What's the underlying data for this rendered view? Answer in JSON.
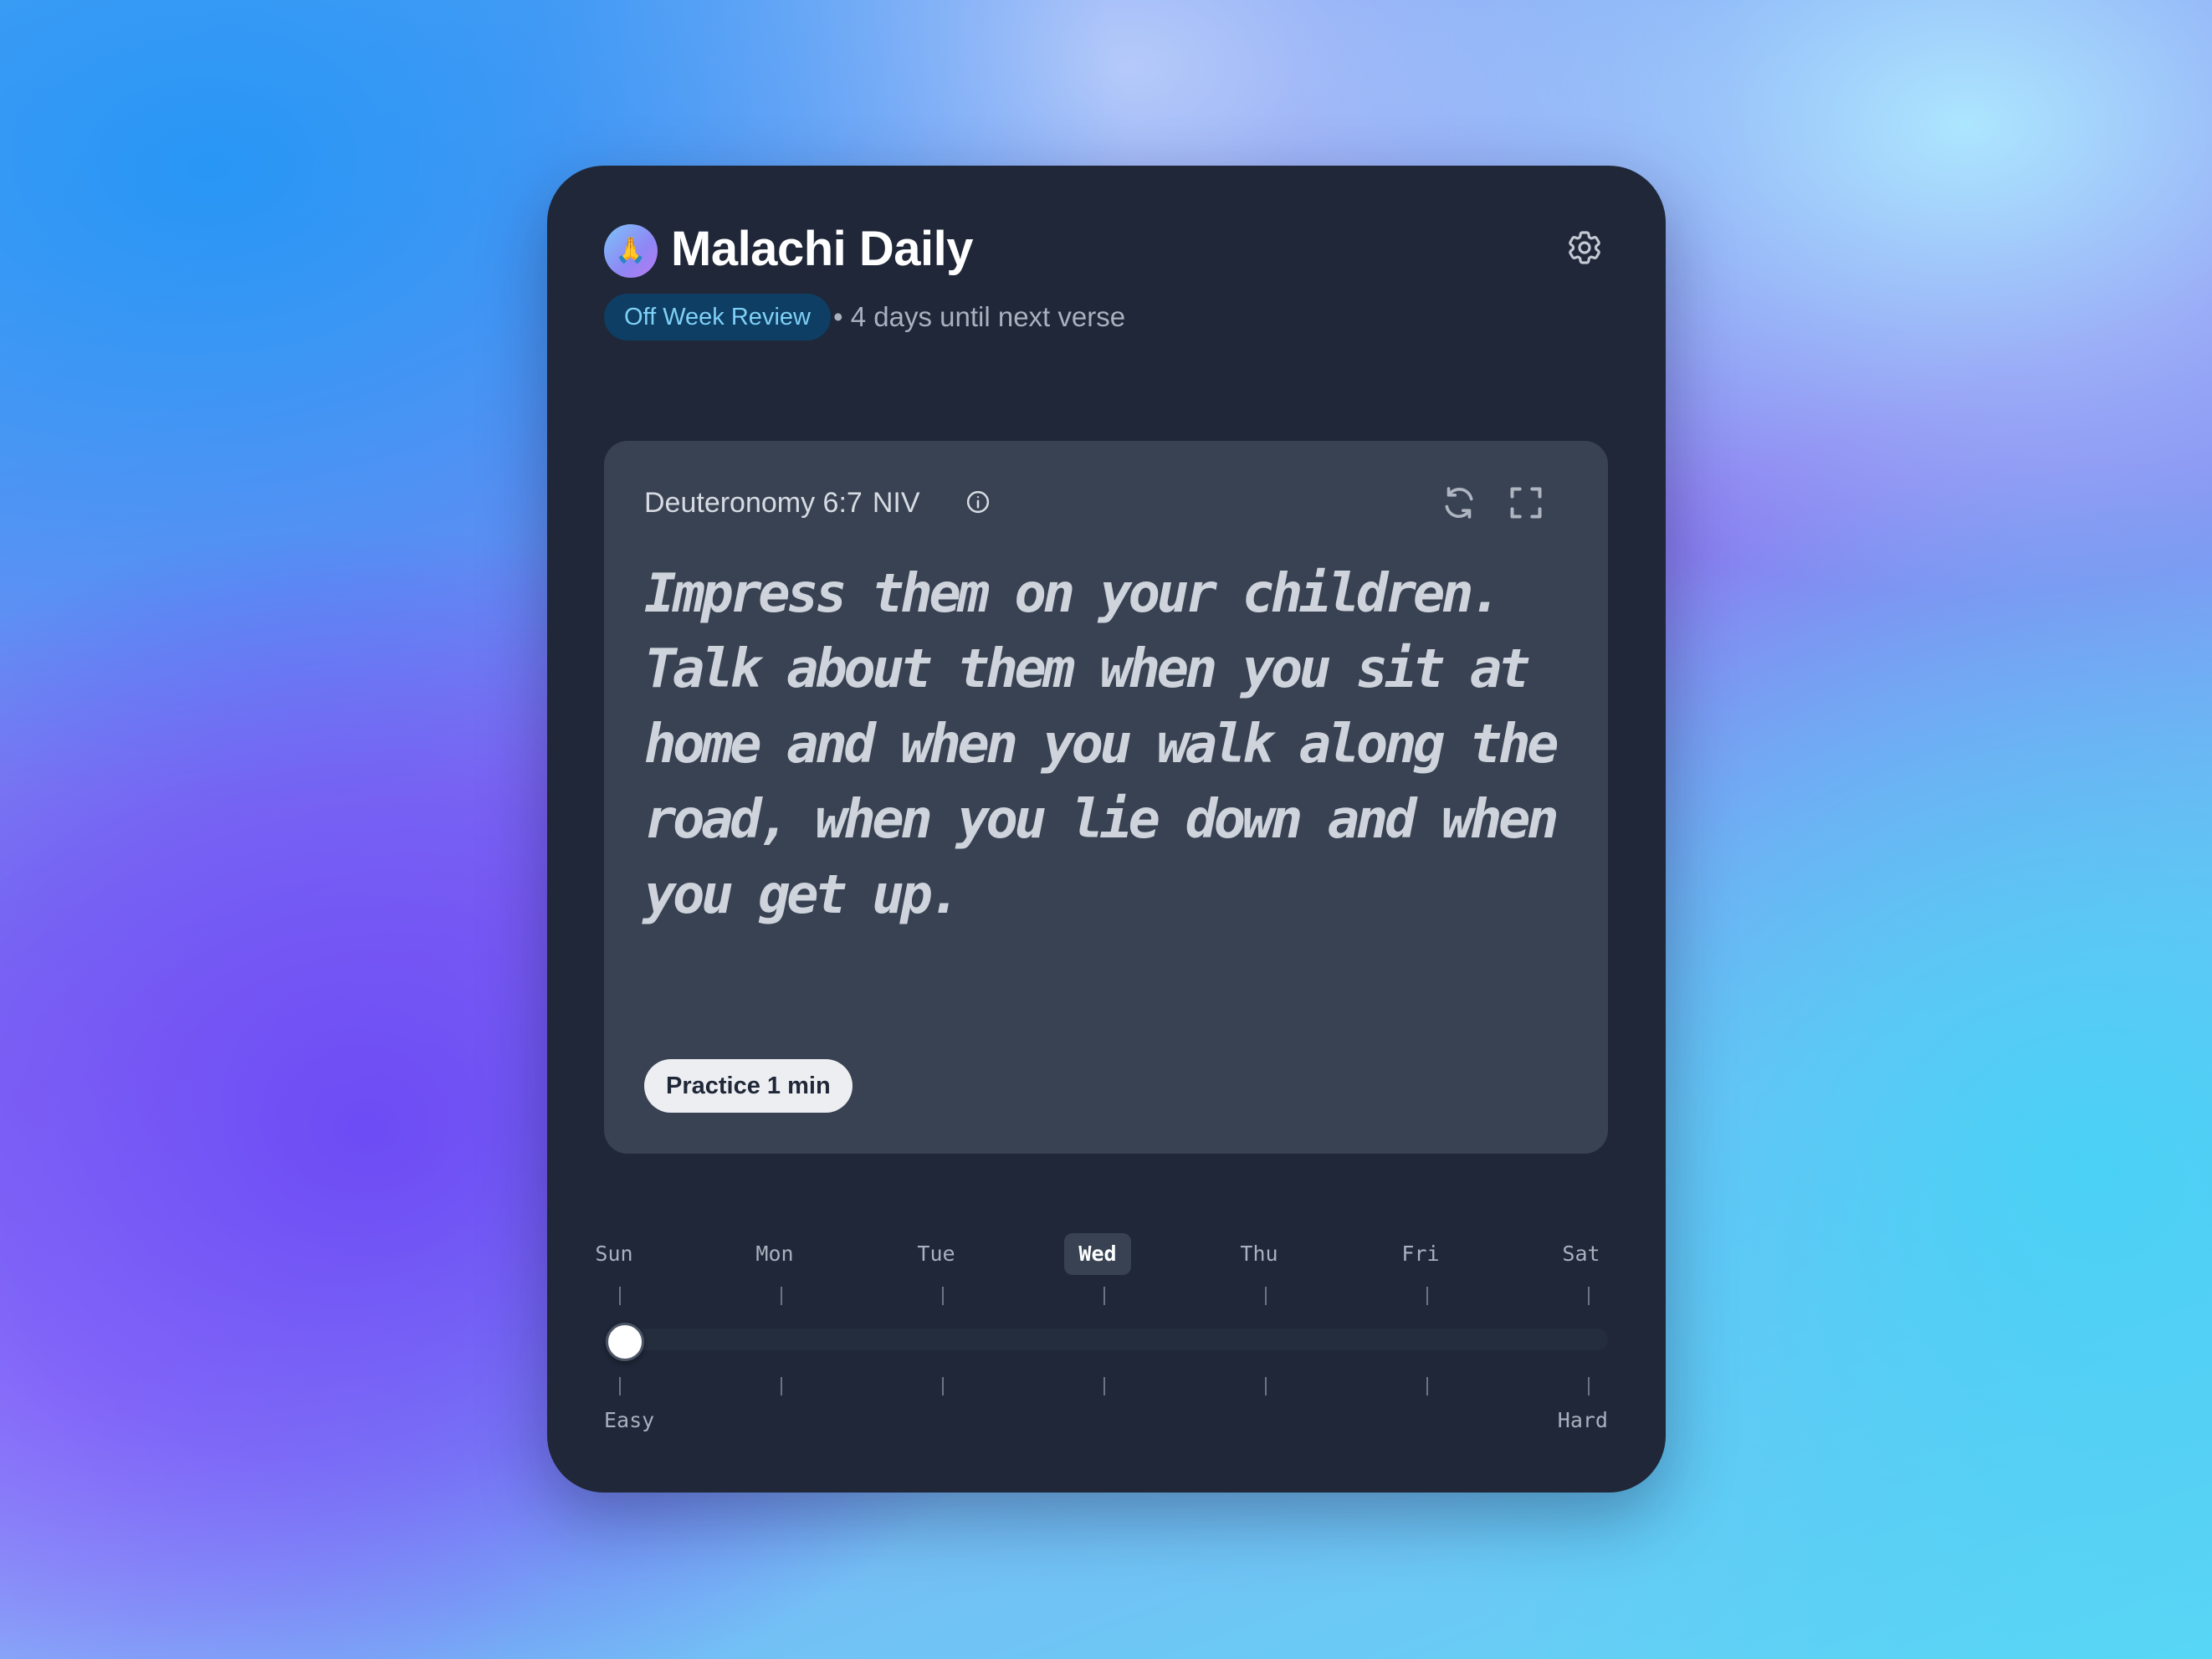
{
  "header": {
    "app_icon_emoji": "🙏",
    "title": "Malachi Daily",
    "status_badge": "Off Week Review",
    "separator": "•",
    "subtitle": "4 days until next verse",
    "settings_icon": "gear-icon"
  },
  "verse_card": {
    "reference": "Deuteronomy 6:7",
    "translation": "NIV",
    "info_icon": "info-icon",
    "refresh_icon": "refresh-icon",
    "fullscreen_icon": "fullscreen-icon",
    "text": "Impress them on your children. Talk about them when you sit at home and when you walk along the road, when you lie down and when you get up.",
    "practice_button": "Practice 1 min"
  },
  "difficulty": {
    "days": [
      "Sun",
      "Mon",
      "Tue",
      "Wed",
      "Thu",
      "Fri",
      "Sat"
    ],
    "active_day": "Wed",
    "easy_label": "Easy",
    "hard_label": "Hard",
    "slider_value": 0
  },
  "colors": {
    "card_background": "#1f2738",
    "inner_card": "#384252",
    "badge_background": "#0e3e63",
    "badge_text": "#7fd0f7"
  }
}
